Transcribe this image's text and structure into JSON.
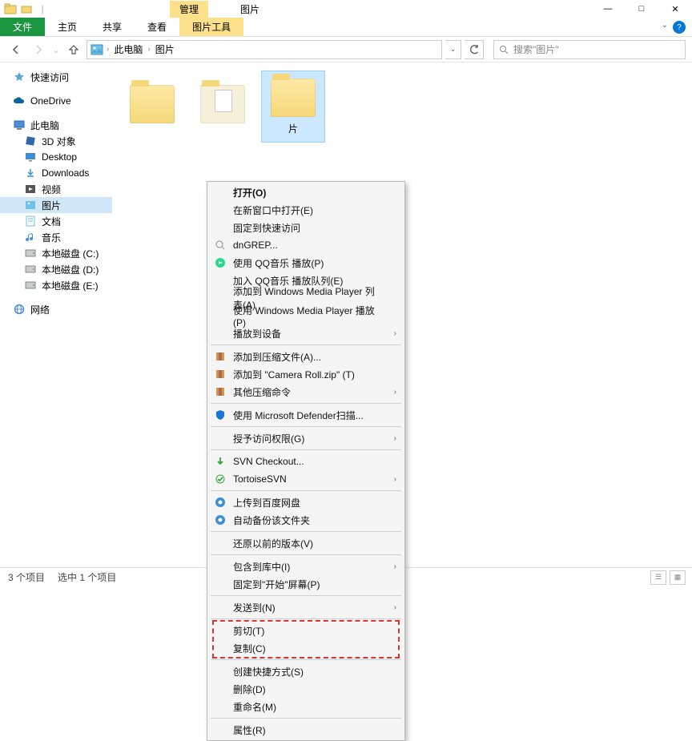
{
  "title_tabs": {
    "manage": "管理",
    "pictures": "图片",
    "tool": "图片工具"
  },
  "ribbon": {
    "file": "文件",
    "home": "主页",
    "share": "共享",
    "view": "查看"
  },
  "win_controls": {
    "min": "—",
    "max": "□",
    "close": "✕"
  },
  "nav": {
    "breadcrumb": [
      "此电脑",
      "图片"
    ],
    "search_placeholder": "搜索\"图片\""
  },
  "tree": {
    "quick_access": "快速访问",
    "onedrive": "OneDrive",
    "this_pc": "此电脑",
    "children": [
      {
        "label": "3D 对象",
        "icon": "3d"
      },
      {
        "label": "Desktop",
        "icon": "desktop"
      },
      {
        "label": "Downloads",
        "icon": "downloads"
      },
      {
        "label": "视频",
        "icon": "videos"
      },
      {
        "label": "图片",
        "icon": "pictures",
        "selected": true
      },
      {
        "label": "文档",
        "icon": "documents"
      },
      {
        "label": "音乐",
        "icon": "music"
      },
      {
        "label": "本地磁盘 (C:)",
        "icon": "drive"
      },
      {
        "label": "本地磁盘 (D:)",
        "icon": "drive"
      },
      {
        "label": "本地磁盘 (E:)",
        "icon": "drive"
      }
    ],
    "network": "网络"
  },
  "folders": [
    {
      "label": "",
      "kind": "folder"
    },
    {
      "label": "",
      "kind": "saved"
    },
    {
      "label": "片",
      "kind": "folder",
      "selected": true
    }
  ],
  "context_menu": [
    {
      "type": "item",
      "label": "打开(O)",
      "bold": true
    },
    {
      "type": "item",
      "label": "在新窗口中打开(E)"
    },
    {
      "type": "item",
      "label": "固定到快速访问"
    },
    {
      "type": "item",
      "label": "dnGREP...",
      "icon": "grep"
    },
    {
      "type": "item",
      "label": "使用 QQ音乐 播放(P)",
      "icon": "qq"
    },
    {
      "type": "item",
      "label": "加入 QQ音乐 播放队列(E)"
    },
    {
      "type": "item",
      "label": "添加到 Windows Media Player 列表(A)"
    },
    {
      "type": "item",
      "label": "使用 Windows Media Player 播放(P)"
    },
    {
      "type": "item",
      "label": "播放到设备",
      "submenu": true
    },
    {
      "type": "sep"
    },
    {
      "type": "item",
      "label": "添加到压缩文件(A)...",
      "icon": "rar"
    },
    {
      "type": "item",
      "label": "添加到 \"Camera Roll.zip\" (T)",
      "icon": "rar"
    },
    {
      "type": "item",
      "label": "其他压缩命令",
      "icon": "rar",
      "submenu": true
    },
    {
      "type": "sep"
    },
    {
      "type": "item",
      "label": "使用 Microsoft Defender扫描...",
      "icon": "defender"
    },
    {
      "type": "sep"
    },
    {
      "type": "item",
      "label": "授予访问权限(G)",
      "submenu": true
    },
    {
      "type": "sep"
    },
    {
      "type": "item",
      "label": "SVN Checkout...",
      "icon": "svn-co"
    },
    {
      "type": "item",
      "label": "TortoiseSVN",
      "icon": "svn",
      "submenu": true
    },
    {
      "type": "sep"
    },
    {
      "type": "item",
      "label": "上传到百度网盘",
      "icon": "baidu"
    },
    {
      "type": "item",
      "label": "自动备份该文件夹",
      "icon": "baidu"
    },
    {
      "type": "sep"
    },
    {
      "type": "item",
      "label": "还原以前的版本(V)"
    },
    {
      "type": "sep"
    },
    {
      "type": "item",
      "label": "包含到库中(I)",
      "submenu": true
    },
    {
      "type": "item",
      "label": "固定到\"开始\"屏幕(P)"
    },
    {
      "type": "sep"
    },
    {
      "type": "item",
      "label": "发送到(N)",
      "submenu": true
    },
    {
      "type": "sep"
    },
    {
      "type": "item",
      "label": "剪切(T)",
      "hl": "start"
    },
    {
      "type": "item",
      "label": "复制(C)",
      "hl": "end"
    },
    {
      "type": "sep"
    },
    {
      "type": "item",
      "label": "创建快捷方式(S)"
    },
    {
      "type": "item",
      "label": "删除(D)"
    },
    {
      "type": "item",
      "label": "重命名(M)"
    },
    {
      "type": "sep"
    },
    {
      "type": "item",
      "label": "属性(R)"
    }
  ],
  "status": {
    "count": "3 个项目",
    "selected": "选中 1 个项目"
  }
}
